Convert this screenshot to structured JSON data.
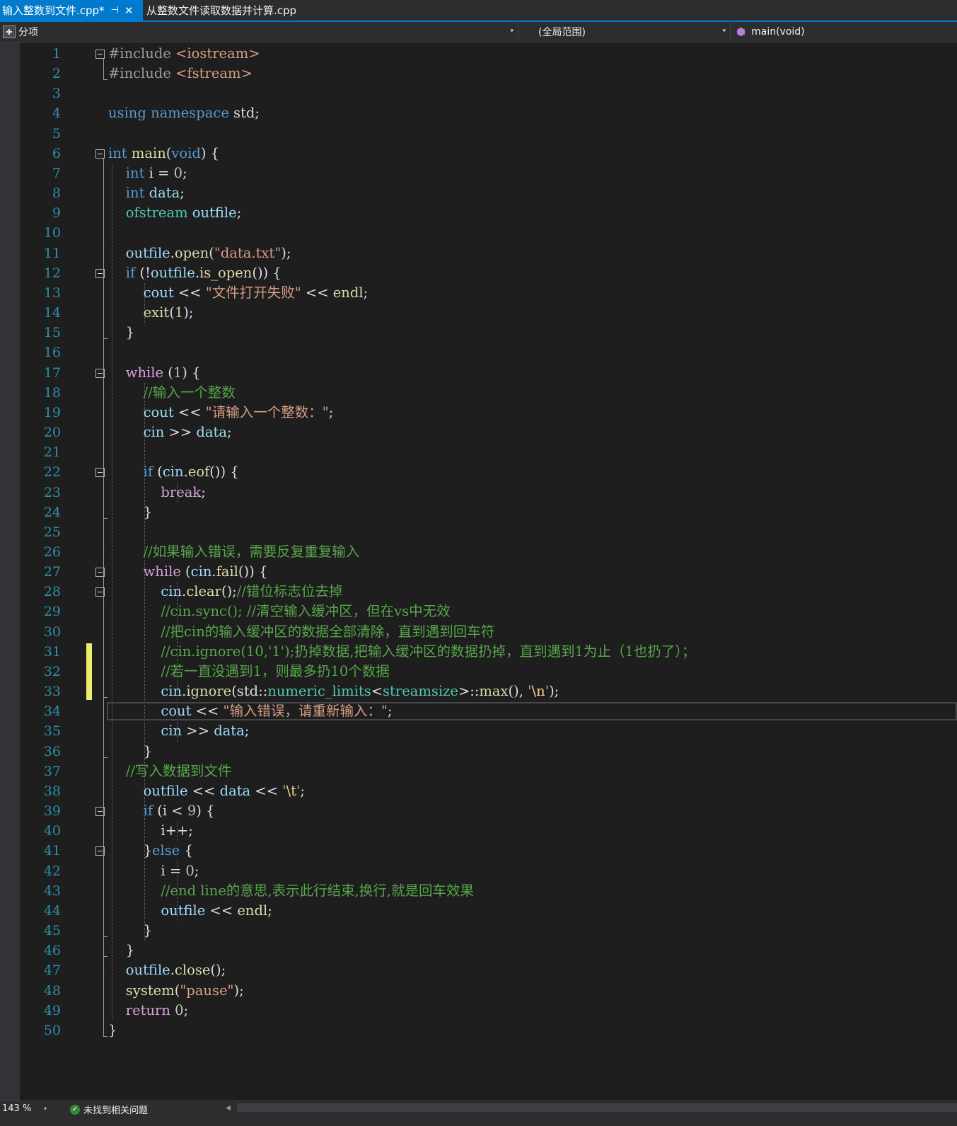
{
  "tabs": [
    {
      "label": "输入整数到文件.cpp*",
      "pin": "⊣",
      "close": "✕"
    },
    {
      "label": "从整数文件读取数据并计算.cpp"
    }
  ],
  "nav": {
    "project": "分项",
    "scope": "(全局范围)",
    "member": "main(void)",
    "dropdown": "▾"
  },
  "status": {
    "zoom": "143 %",
    "zoom_dropdown": "▾",
    "message": "未找到相关问题"
  },
  "colors": {
    "accent": "#007acc",
    "background": "#1e1e1e",
    "keyword": "#569cd6",
    "comment": "#57a64a",
    "string": "#d69d85",
    "type": "#4ec9b0",
    "function": "#dcdcaa",
    "line_number": "#2b91af",
    "change_bar": "#eeec6a"
  },
  "editor": {
    "current_line": 34,
    "changed_lines": [
      31,
      32,
      33
    ],
    "code": [
      [
        [
          "pp",
          "#include "
        ],
        [
          "str",
          "<iostream>"
        ]
      ],
      [
        [
          "pp",
          "#include "
        ],
        [
          "str",
          "<fstream>"
        ]
      ],
      [],
      [
        [
          "kw",
          "using"
        ],
        [
          "p",
          " "
        ],
        [
          "kw",
          "namespace"
        ],
        [
          "p",
          " std;"
        ]
      ],
      [],
      [
        [
          "kw",
          "int"
        ],
        [
          "p",
          " "
        ],
        [
          "fn",
          "main"
        ],
        [
          "p",
          "("
        ],
        [
          "kw",
          "void"
        ],
        [
          "p",
          ") {"
        ]
      ],
      [
        [
          "p",
          "    "
        ],
        [
          "kw",
          "int"
        ],
        [
          "p",
          " i = "
        ],
        [
          "num",
          "0"
        ],
        [
          "p",
          ";"
        ]
      ],
      [
        [
          "p",
          "    "
        ],
        [
          "kw",
          "int"
        ],
        [
          "p",
          " "
        ],
        [
          "var",
          "data"
        ],
        [
          "p",
          ";"
        ]
      ],
      [
        [
          "p",
          "    "
        ],
        [
          "ty",
          "ofstream"
        ],
        [
          "p",
          " "
        ],
        [
          "var",
          "outfile"
        ],
        [
          "p",
          ";"
        ]
      ],
      [],
      [
        [
          "p",
          "    "
        ],
        [
          "var",
          "outfile"
        ],
        [
          "p",
          "."
        ],
        [
          "fn",
          "open"
        ],
        [
          "p",
          "("
        ],
        [
          "str",
          "\"data.txt\""
        ],
        [
          "p",
          ");"
        ]
      ],
      [
        [
          "p",
          "    "
        ],
        [
          "kw",
          "if"
        ],
        [
          "p",
          " (!"
        ],
        [
          "var",
          "outfile"
        ],
        [
          "p",
          "."
        ],
        [
          "fn",
          "is_open"
        ],
        [
          "p",
          "()) {"
        ]
      ],
      [
        [
          "p",
          "        "
        ],
        [
          "var",
          "cout"
        ],
        [
          "p",
          " << "
        ],
        [
          "str",
          "\"文件打开失败\""
        ],
        [
          "p",
          " << "
        ],
        [
          "fn",
          "endl"
        ],
        [
          "p",
          ";"
        ]
      ],
      [
        [
          "p",
          "        "
        ],
        [
          "fn",
          "exit"
        ],
        [
          "p",
          "("
        ],
        [
          "num",
          "1"
        ],
        [
          "p",
          ");"
        ]
      ],
      [
        [
          "p",
          "    }"
        ]
      ],
      [],
      [
        [
          "p",
          "    "
        ],
        [
          "ctl",
          "while"
        ],
        [
          "p",
          " ("
        ],
        [
          "num",
          "1"
        ],
        [
          "p",
          ") {"
        ]
      ],
      [
        [
          "p",
          "        "
        ],
        [
          "cm",
          "//输入一个整数"
        ]
      ],
      [
        [
          "p",
          "        "
        ],
        [
          "var",
          "cout"
        ],
        [
          "p",
          " << "
        ],
        [
          "str",
          "\"请输入一个整数：\""
        ],
        [
          "p",
          ";"
        ]
      ],
      [
        [
          "p",
          "        "
        ],
        [
          "var",
          "cin"
        ],
        [
          "p",
          " >> "
        ],
        [
          "var",
          "data"
        ],
        [
          "p",
          ";"
        ]
      ],
      [],
      [
        [
          "p",
          "        "
        ],
        [
          "kw",
          "if"
        ],
        [
          "p",
          " ("
        ],
        [
          "var",
          "cin"
        ],
        [
          "p",
          "."
        ],
        [
          "fn",
          "eof"
        ],
        [
          "p",
          "()) {"
        ]
      ],
      [
        [
          "p",
          "            "
        ],
        [
          "ctl",
          "break"
        ],
        [
          "p",
          ";"
        ]
      ],
      [
        [
          "p",
          "        }"
        ]
      ],
      [],
      [
        [
          "p",
          "        "
        ],
        [
          "cm",
          "//如果输入错误，需要反复重复输入"
        ]
      ],
      [
        [
          "p",
          "        "
        ],
        [
          "ctl",
          "while"
        ],
        [
          "p",
          " ("
        ],
        [
          "var",
          "cin"
        ],
        [
          "p",
          "."
        ],
        [
          "fn",
          "fail"
        ],
        [
          "p",
          "()) {"
        ]
      ],
      [
        [
          "p",
          "            "
        ],
        [
          "var",
          "cin"
        ],
        [
          "p",
          "."
        ],
        [
          "fn",
          "clear"
        ],
        [
          "p",
          "();"
        ],
        [
          "cm",
          "//错位标志位去掉"
        ]
      ],
      [
        [
          "p",
          "            "
        ],
        [
          "cm",
          "//cin.sync(); //清空输入缓冲区，但在vs中无效"
        ]
      ],
      [
        [
          "p",
          "            "
        ],
        [
          "cm",
          "//把cin的输入缓冲区的数据全部清除，直到遇到回车符"
        ]
      ],
      [
        [
          "p",
          "            "
        ],
        [
          "cm",
          "//cin.ignore(10,'1');扔掉数据,把输入缓冲区的数据扔掉，直到遇到1为止（1也扔了）；"
        ]
      ],
      [
        [
          "p",
          "            "
        ],
        [
          "cm",
          "//若一直没遇到1，则最多扔10个数据"
        ]
      ],
      [
        [
          "p",
          "            "
        ],
        [
          "var",
          "cin"
        ],
        [
          "p",
          "."
        ],
        [
          "fn",
          "ignore"
        ],
        [
          "p",
          "(std::"
        ],
        [
          "ty",
          "numeric_limits"
        ],
        [
          "p",
          "<"
        ],
        [
          "ty",
          "streamsize"
        ],
        [
          "p",
          ">::"
        ],
        [
          "fn",
          "max"
        ],
        [
          "p",
          "(), "
        ],
        [
          "str",
          "'"
        ],
        [
          "esc",
          "\\n"
        ],
        [
          "str",
          "'"
        ],
        [
          "p",
          ");"
        ]
      ],
      [
        [
          "p",
          "            "
        ],
        [
          "var",
          "cout"
        ],
        [
          "p",
          " << "
        ],
        [
          "str",
          "\"输入错误，请重新输入：\""
        ],
        [
          "p",
          ";"
        ]
      ],
      [
        [
          "p",
          "            "
        ],
        [
          "var",
          "cin"
        ],
        [
          "p",
          " >> "
        ],
        [
          "var",
          "data"
        ],
        [
          "p",
          ";"
        ]
      ],
      [
        [
          "p",
          "        }"
        ]
      ],
      [
        [
          "p",
          "    "
        ],
        [
          "cm",
          "//写入数据到文件"
        ]
      ],
      [
        [
          "p",
          "        "
        ],
        [
          "var",
          "outfile"
        ],
        [
          "p",
          " << "
        ],
        [
          "var",
          "data"
        ],
        [
          "p",
          " << "
        ],
        [
          "str",
          "'"
        ],
        [
          "esc",
          "\\t"
        ],
        [
          "str",
          "'"
        ],
        [
          "p",
          ";"
        ]
      ],
      [
        [
          "p",
          "        "
        ],
        [
          "kw",
          "if"
        ],
        [
          "p",
          " (i < "
        ],
        [
          "num",
          "9"
        ],
        [
          "p",
          ") {"
        ]
      ],
      [
        [
          "p",
          "            i++;"
        ]
      ],
      [
        [
          "p",
          "        }"
        ],
        [
          "kw",
          "else"
        ],
        [
          "p",
          " {"
        ]
      ],
      [
        [
          "p",
          "            i = "
        ],
        [
          "num",
          "0"
        ],
        [
          "p",
          ";"
        ]
      ],
      [
        [
          "p",
          "            "
        ],
        [
          "cm",
          "//end line的意思,表示此行结束,换行,就是回车效果"
        ]
      ],
      [
        [
          "p",
          "            "
        ],
        [
          "var",
          "outfile"
        ],
        [
          "p",
          " << "
        ],
        [
          "fn",
          "endl"
        ],
        [
          "p",
          ";"
        ]
      ],
      [
        [
          "p",
          "        }"
        ]
      ],
      [
        [
          "p",
          "    }"
        ]
      ],
      [
        [
          "p",
          "    "
        ],
        [
          "var",
          "outfile"
        ],
        [
          "p",
          "."
        ],
        [
          "fn",
          "close"
        ],
        [
          "p",
          "();"
        ]
      ],
      [
        [
          "p",
          "    "
        ],
        [
          "fn",
          "system"
        ],
        [
          "p",
          "("
        ],
        [
          "str",
          "\"pause\""
        ],
        [
          "p",
          ");"
        ]
      ],
      [
        [
          "p",
          "    "
        ],
        [
          "ctl",
          "return"
        ],
        [
          "p",
          " "
        ],
        [
          "num",
          "0"
        ],
        [
          "p",
          ";"
        ]
      ],
      [
        [
          "p",
          "}"
        ]
      ]
    ]
  }
}
